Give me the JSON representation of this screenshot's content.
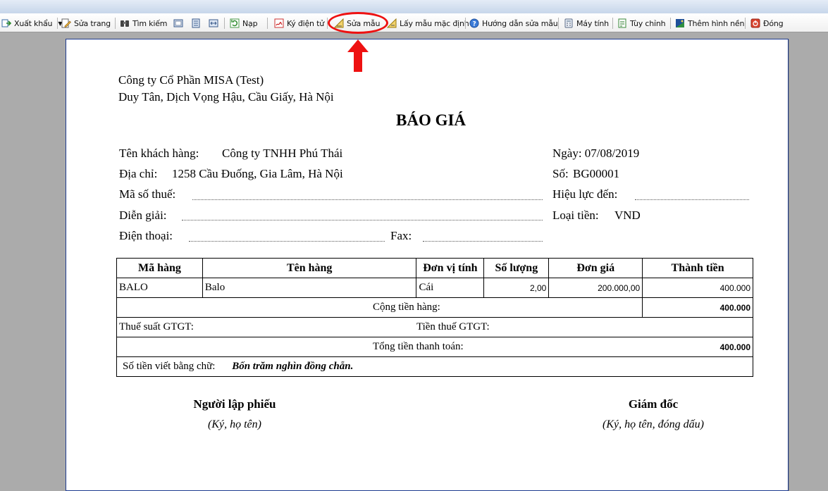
{
  "toolbar": {
    "items": [
      {
        "label": "Xuất khẩu",
        "icon": "export-icon"
      },
      {
        "label": "Sửa trang",
        "icon": "edit-page-icon"
      },
      {
        "label": "Tìm kiếm",
        "icon": "binoculars-icon"
      },
      {
        "label": "Nạp",
        "icon": "refresh-icon"
      },
      {
        "label": "Ký điện tử",
        "icon": "digital-sign-icon"
      },
      {
        "label": "Sửa mẫu",
        "icon": "edit-template-icon"
      },
      {
        "label": "Lấy mẫu mặc định",
        "icon": "default-template-icon"
      },
      {
        "label": "Hướng dẫn sửa mẫu",
        "icon": "help-icon"
      },
      {
        "label": "Máy tính",
        "icon": "calculator-icon"
      },
      {
        "label": "Tùy chỉnh",
        "icon": "customize-icon"
      },
      {
        "label": "Thêm hình nền",
        "icon": "background-icon"
      },
      {
        "label": "Đóng",
        "icon": "close-icon"
      }
    ],
    "highlight_color": "#e11111"
  },
  "document": {
    "company_name": "Công ty Cổ Phần MISA (Test)",
    "company_address": "Duy Tân, Dịch Vọng Hậu, Cầu Giấy, Hà Nội",
    "title": "BÁO GIÁ",
    "customer_label": "Tên khách hàng:",
    "customer_value": "Công ty TNHH Phú Thái",
    "address_label": "Địa chỉ:",
    "address_value": "1258 Cầu Đuống, Gia Lâm, Hà Nội",
    "tax_label": "Mã số thuế:",
    "desc_label": "Diễn giải:",
    "phone_label": "Điện thoại:",
    "fax_label": "Fax:",
    "date_text": "Ngày: 07/08/2019",
    "number_label": "Số:",
    "number_value": "BG00001",
    "valid_label": "Hiệu lực đến:",
    "currency_label": "Loại tiền:",
    "currency_value": "VND"
  },
  "table": {
    "headers": [
      "Mã hàng",
      "Tên hàng",
      "Đơn vị tính",
      "Số lượng",
      "Đơn giá",
      "Thành tiền"
    ],
    "rows": [
      {
        "code": "BALO",
        "name": "Balo",
        "unit": "Cái",
        "qty": "2,00",
        "price": "200.000,00",
        "amount": "400.000"
      }
    ],
    "subtotal_label": "Cộng tiền hàng:",
    "subtotal_value": "400.000",
    "vat_rate_label": "Thuế suất GTGT:",
    "vat_amount_label": "Tiền thuế GTGT:",
    "total_label": "Tổng tiền thanh toán:",
    "total_value": "400.000",
    "words_label": "Số tiền viết bằng chữ:",
    "words_value": "Bốn trăm nghìn đồng chẵn."
  },
  "signatures": {
    "preparer_title": "Người lập phiếu",
    "preparer_note": "(Ký, họ tên)",
    "director_title": "Giám đốc",
    "director_note": "(Ký, họ tên, đóng dấu)"
  }
}
